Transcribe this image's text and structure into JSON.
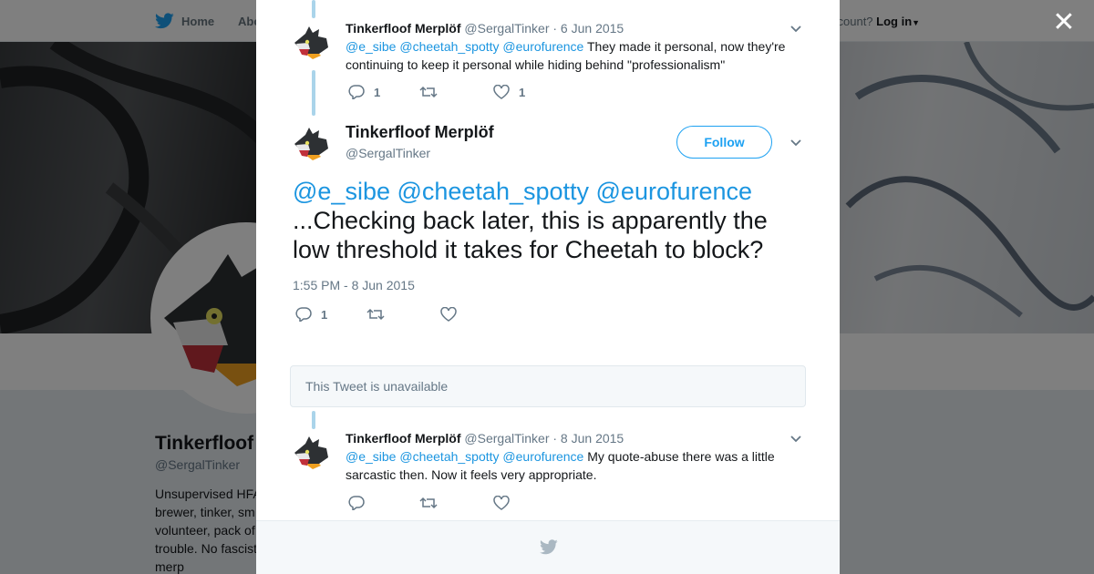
{
  "nav": {
    "home_label": "Home",
    "about_label": "Abo",
    "account_prefix": "ccount?",
    "login_label": "Log in"
  },
  "profile": {
    "name": "Tinkerfloof",
    "handle": "@SergalTinker",
    "bio": "Unsupervised HFA\nbrewer, tinker, sm\nvolunteer, pack of\ntrouble. No fascist\nmerp"
  },
  "modal": {
    "tweets": [
      {
        "name": "Tinkerfloof Merplöf",
        "handle": "@SergalTinker",
        "date": "· 6 Jun 2015",
        "mentions": "@e_sibe @cheetah_spotty @eurofurence",
        "text": " They made it personal, now they're continuing to keep it personal while hiding behind \"professionalism\"",
        "reply_count": "1",
        "retweet_count": "",
        "like_count": "1"
      },
      {
        "name": "Tinkerfloof Merplöf",
        "handle": "@SergalTinker",
        "date": "· 8 Jun 2015",
        "mentions": "@e_sibe @cheetah_spotty @eurofurence",
        "text": " My quote-abuse there was a little sarcastic then. Now it feels very appropriate.",
        "reply_count": "",
        "retweet_count": "",
        "like_count": ""
      }
    ],
    "main": {
      "name": "Tinkerfloof Merplöf",
      "handle": "@SergalTinker",
      "follow_label": "Follow",
      "mentions": "@e_sibe @cheetah_spotty @eurofurence",
      "text": "...Checking back later, this is apparently the low threshold it takes for Cheetah to block?",
      "timestamp": "1:55 PM - 8 Jun 2015",
      "reply_count": "1",
      "retweet_count": "",
      "like_count": ""
    },
    "unavailable_text": "This Tweet is unavailable"
  },
  "colors": {
    "accent": "#1da1f2",
    "link": "#1b95e0",
    "muted": "#657786",
    "thread": "#aad4ea"
  },
  "icons": [
    "twitter-bird-icon",
    "close-icon",
    "reply-icon",
    "retweet-icon",
    "heart-icon",
    "chevron-down-icon"
  ]
}
